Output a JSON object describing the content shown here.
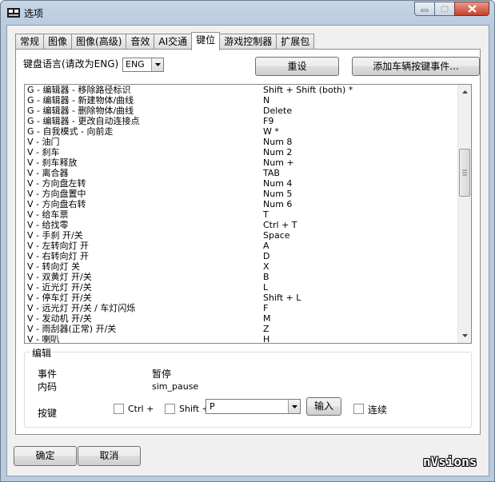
{
  "window": {
    "title": "选项",
    "controls": {
      "minimize": "minimize-icon",
      "maximize": "maximize-icon",
      "close": "close-icon"
    }
  },
  "tabs": [
    {
      "label": "常规"
    },
    {
      "label": "图像"
    },
    {
      "label": "图像(高级)"
    },
    {
      "label": "音效"
    },
    {
      "label": "AI交通"
    },
    {
      "label": "键位",
      "active": true
    },
    {
      "label": "游戏控制器"
    },
    {
      "label": "扩展包"
    }
  ],
  "keyboard": {
    "language_label": "键盘语言(请改为ENG)",
    "language_value": "ENG",
    "reset_label": "重设",
    "add_vehicle_key_label": "添加车辆按键事件..."
  },
  "bindings": [
    {
      "action": "G - 编辑器 - 移除路径标识",
      "key": "Shift + Shift (both) *"
    },
    {
      "action": "G - 编辑器 - 新建物体/曲线",
      "key": "N"
    },
    {
      "action": "G - 编辑器 - 删除物体/曲线",
      "key": "Delete"
    },
    {
      "action": "G - 编辑器 - 更改自动连接点",
      "key": "F9"
    },
    {
      "action": "G - 自我模式 - 向前走",
      "key": "W *"
    },
    {
      "action": "V - 油门",
      "key": "Num 8"
    },
    {
      "action": "V - 刹车",
      "key": "Num 2"
    },
    {
      "action": "V - 刹车释放",
      "key": "Num +"
    },
    {
      "action": "V - 离合器",
      "key": "TAB"
    },
    {
      "action": "V - 方向盘左转",
      "key": "Num 4"
    },
    {
      "action": "V - 方向盘置中",
      "key": "Num 5"
    },
    {
      "action": "V - 方向盘右转",
      "key": "Num 6"
    },
    {
      "action": "V - 给车票",
      "key": "T"
    },
    {
      "action": "V - 给找零",
      "key": "Ctrl + T"
    },
    {
      "action": "V - 手刹 开/关",
      "key": "Space"
    },
    {
      "action": "V - 左转向灯 开",
      "key": "A"
    },
    {
      "action": "V - 右转向灯 开",
      "key": "D"
    },
    {
      "action": "V - 转向灯 关",
      "key": "X"
    },
    {
      "action": "V - 双黄灯 开/关",
      "key": "B"
    },
    {
      "action": "V - 近光灯 开/关",
      "key": "L"
    },
    {
      "action": "V - 停车灯 开/关",
      "key": "Shift + L"
    },
    {
      "action": "V - 远光灯 开/关 / 车灯闪烁",
      "key": "F"
    },
    {
      "action": "V - 发动机 开/关",
      "key": "M"
    },
    {
      "action": "V - 雨刮器(正常) 开/关",
      "key": "Z"
    },
    {
      "action": "V - 喇叭",
      "key": "H"
    }
  ],
  "edit": {
    "group_title": "编辑",
    "event_label": "事件",
    "event_value": "暂停",
    "code_label": "内码",
    "code_value": "sim_pause",
    "key_label": "按键",
    "ctrl_label": "Ctrl +",
    "shift_label": "Shift +",
    "key_value": "P",
    "input_label": "输入",
    "continuous_label": "连续"
  },
  "footer": {
    "ok_label": "确定",
    "cancel_label": "取消"
  },
  "watermark": "nVsions"
}
